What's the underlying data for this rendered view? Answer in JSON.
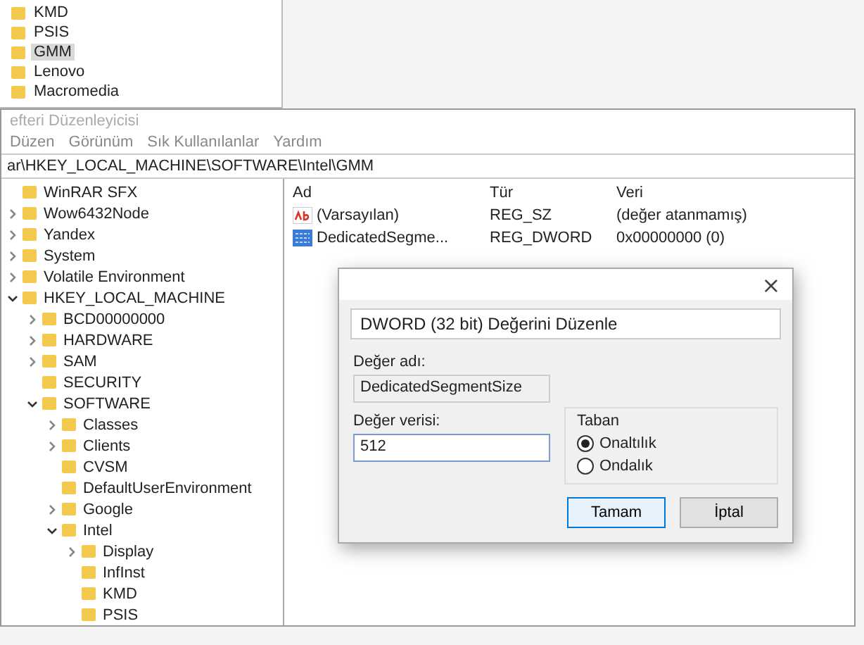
{
  "background_tree": {
    "items": [
      {
        "label": "KMD",
        "selected": false
      },
      {
        "label": "PSIS",
        "selected": false
      },
      {
        "label": "GMM",
        "selected": true
      },
      {
        "label": "Lenovo",
        "selected": false
      },
      {
        "label": "Macromedia",
        "selected": false
      }
    ]
  },
  "window": {
    "title": "efteri Düzenleyicisi",
    "menu": [
      "Düzen",
      "Görünüm",
      "Sık Kullanılanlar",
      "Yardım"
    ],
    "address": "ar\\HKEY_LOCAL_MACHINE\\SOFTWARE\\Intel\\GMM",
    "tree": [
      {
        "label": "WinRAR SFX",
        "expandable": false
      },
      {
        "label": "Wow6432Node",
        "expandable": true,
        "expanded": false
      },
      {
        "label": "Yandex",
        "expandable": true,
        "expanded": false
      },
      {
        "label": "System",
        "expandable": true,
        "expanded": false
      },
      {
        "label": "Volatile Environment",
        "expandable": true,
        "expanded": false
      },
      {
        "label": "HKEY_LOCAL_MACHINE",
        "expandable": true,
        "expanded": true,
        "children": [
          {
            "label": "BCD00000000",
            "expandable": true,
            "expanded": false
          },
          {
            "label": "HARDWARE",
            "expandable": true,
            "expanded": false
          },
          {
            "label": "SAM",
            "expandable": true,
            "expanded": false
          },
          {
            "label": "SECURITY",
            "expandable": false
          },
          {
            "label": "SOFTWARE",
            "expandable": true,
            "expanded": true,
            "children": [
              {
                "label": "Classes",
                "expandable": true,
                "expanded": false
              },
              {
                "label": "Clients",
                "expandable": true,
                "expanded": false
              },
              {
                "label": "CVSM",
                "expandable": false
              },
              {
                "label": "DefaultUserEnvironment",
                "expandable": false
              },
              {
                "label": "Google",
                "expandable": true,
                "expanded": false
              },
              {
                "label": "Intel",
                "expandable": true,
                "expanded": true,
                "children": [
                  {
                    "label": "Display",
                    "expandable": true,
                    "expanded": false
                  },
                  {
                    "label": "InfInst",
                    "expandable": false
                  },
                  {
                    "label": "KMD",
                    "expandable": false
                  },
                  {
                    "label": "PSIS",
                    "expandable": false
                  }
                ]
              }
            ]
          }
        ]
      }
    ],
    "values": {
      "columns": [
        "Ad",
        "Tür",
        "Veri"
      ],
      "rows": [
        {
          "kind": "string",
          "name": "(Varsayılan)",
          "type": "REG_SZ",
          "data": "(değer atanmamış)"
        },
        {
          "kind": "binary",
          "name": "DedicatedSegme...",
          "type": "REG_DWORD",
          "data": "0x00000000 (0)"
        }
      ]
    }
  },
  "dialog": {
    "title": "DWORD (32 bit) Değerini Düzenle",
    "close": "×",
    "name_label": "Değer adı:",
    "name_value": "DedicatedSegmentSize",
    "data_label": "Değer verisi:",
    "data_value": "512",
    "base": {
      "label": "Taban",
      "options": [
        {
          "label": "Onaltılık",
          "selected": true
        },
        {
          "label": "Ondalık",
          "selected": false
        }
      ]
    },
    "buttons": [
      {
        "label": "Tamam",
        "default": true
      },
      {
        "label": "İptal",
        "default": false
      }
    ]
  }
}
